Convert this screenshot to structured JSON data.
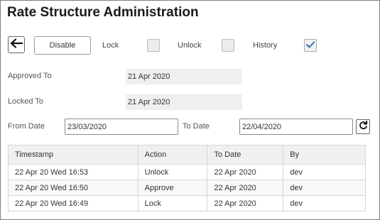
{
  "page": {
    "title": "Rate Structure Administration"
  },
  "toolbar": {
    "back_icon": "arrow-left-icon",
    "disable_label": "Disable",
    "lock_label": "Lock",
    "lock_checked": false,
    "unlock_label": "Unlock",
    "unlock_checked": false,
    "history_label": "History",
    "history_checked": true
  },
  "approved_to": {
    "label": "Approved To",
    "value": "21 Apr 2020"
  },
  "locked_to": {
    "label": "Locked To",
    "value": "21 Apr 2020"
  },
  "filter": {
    "from_label": "From Date",
    "from_value": "23/03/2020",
    "to_label": "To Date",
    "to_value": "22/04/2020",
    "refresh_icon": "refresh-icon"
  },
  "history_table": {
    "columns": [
      "Timestamp",
      "Action",
      "To Date",
      "By"
    ],
    "rows": [
      [
        "22 Apr 20 Wed 16:53",
        "Unlock",
        "22 Apr 2020",
        "dev"
      ],
      [
        "22 Apr 20 Wed 16:50",
        "Approve",
        "22 Apr 2020",
        "dev"
      ],
      [
        "22 Apr 20 Wed 16:49",
        "Lock",
        "22 Apr 2020",
        "dev"
      ]
    ]
  }
}
